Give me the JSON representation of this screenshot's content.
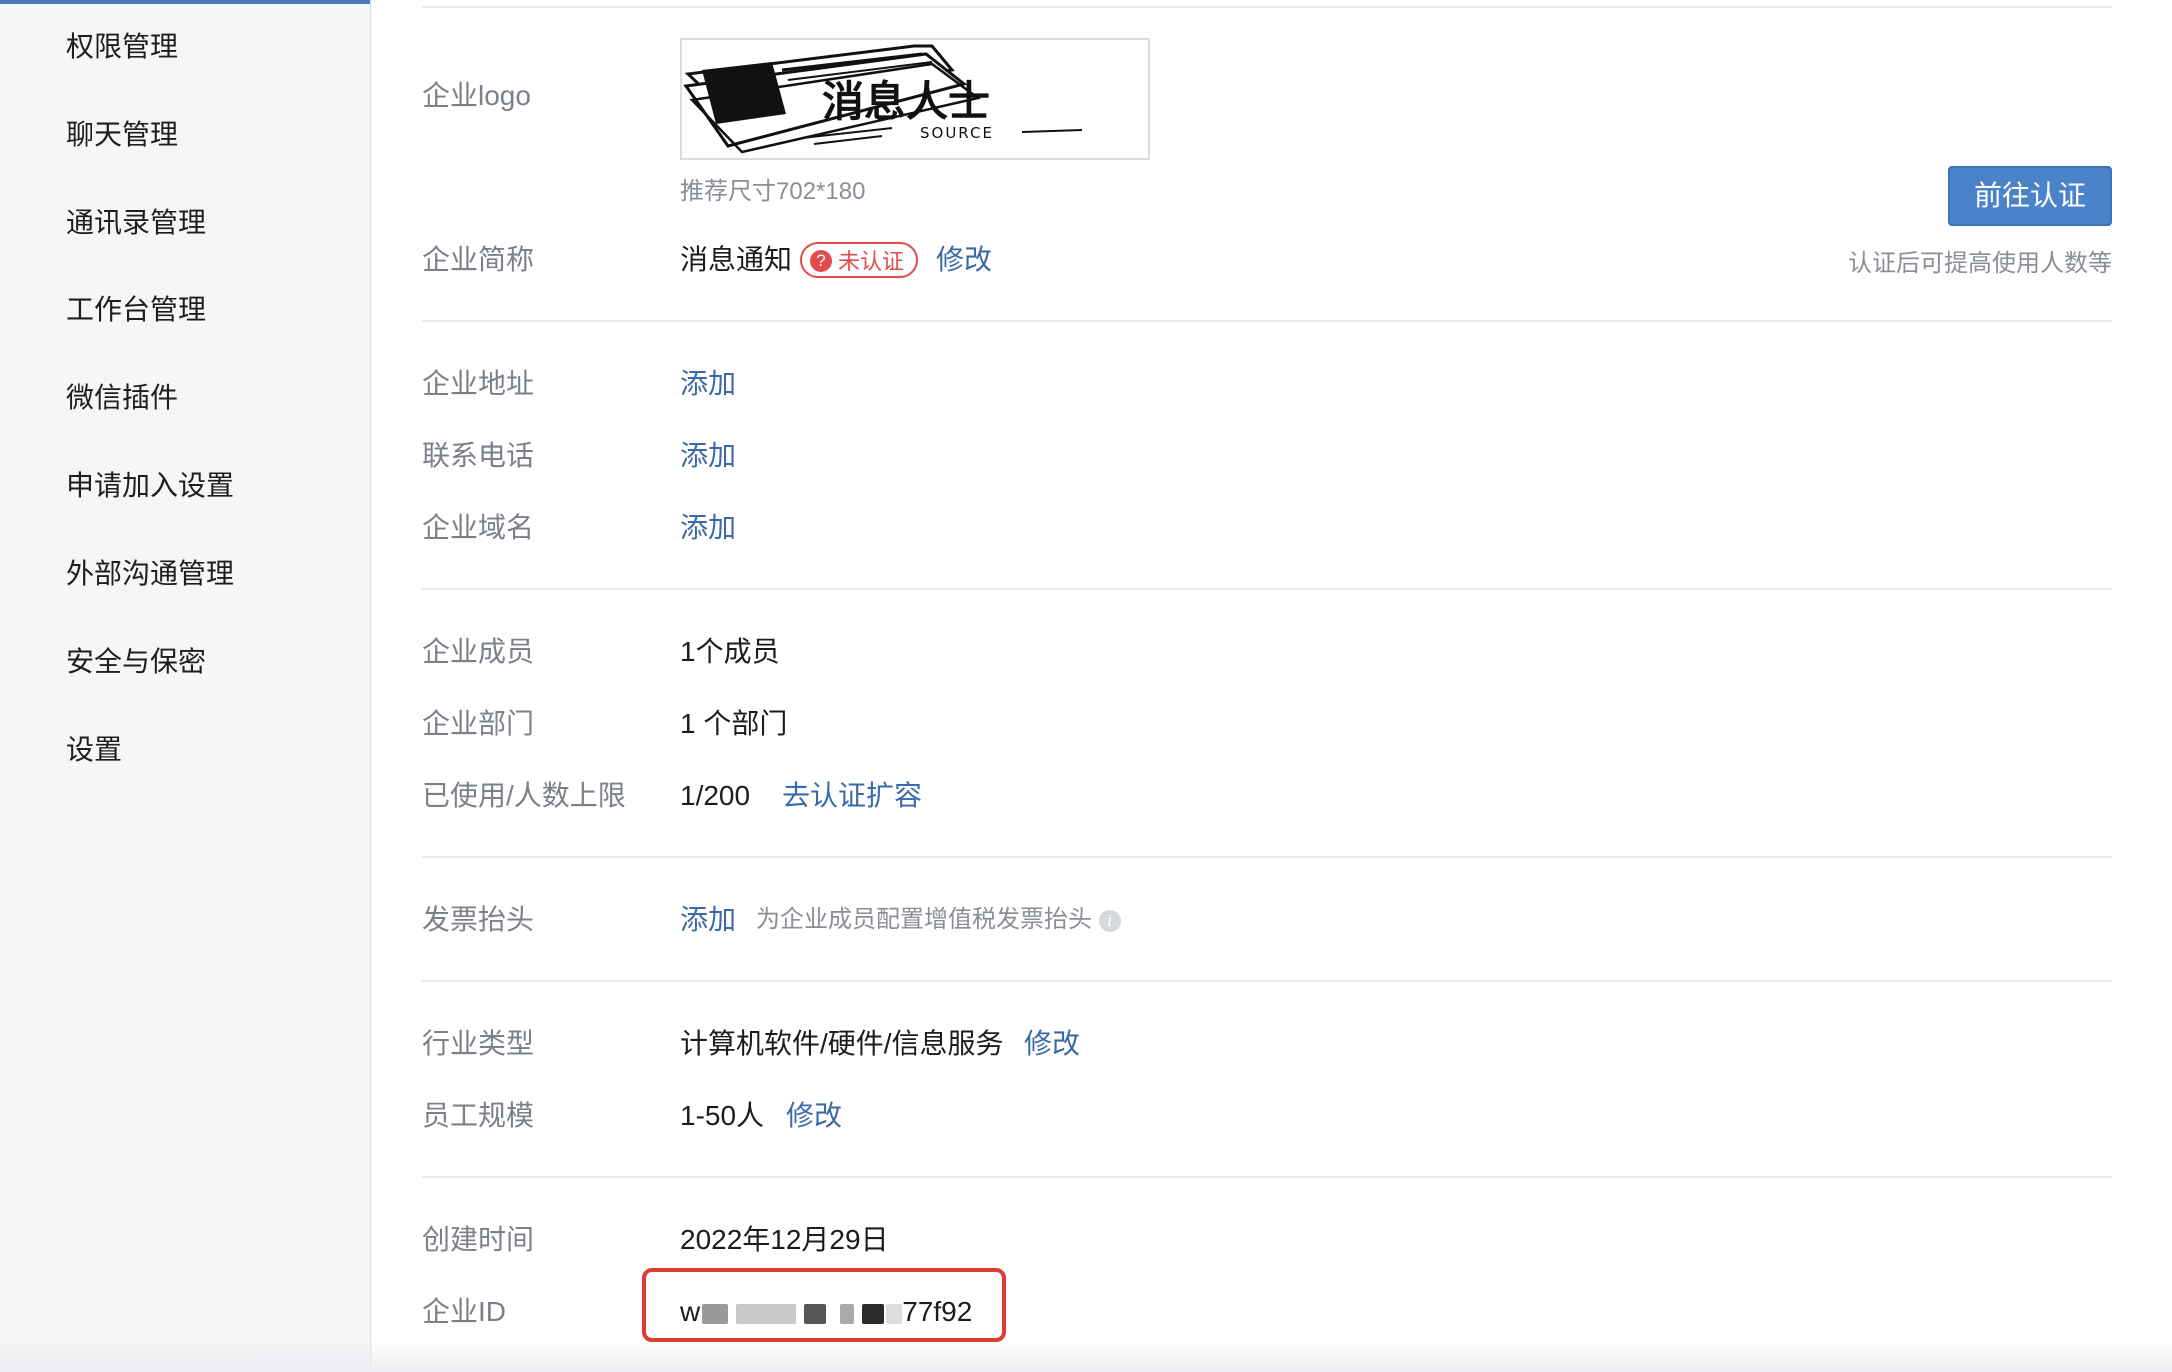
{
  "sidebar": {
    "items": [
      {
        "label": "权限管理"
      },
      {
        "label": "聊天管理"
      },
      {
        "label": "通讯录管理"
      },
      {
        "label": "工作台管理"
      },
      {
        "label": "微信插件"
      },
      {
        "label": "申请加入设置"
      },
      {
        "label": "外部沟通管理"
      },
      {
        "label": "安全与保密"
      },
      {
        "label": "设置"
      }
    ]
  },
  "logo": {
    "label": "企业logo",
    "brand_text": "消息人士",
    "brand_sub": "SOURCE",
    "hint": "推荐尺寸702*180"
  },
  "auth": {
    "button_label": "前往认证",
    "note": "认证后可提高使用人数等"
  },
  "short_name": {
    "label": "企业简称",
    "value": "消息通知",
    "badge": "未认证",
    "badge_icon": "?",
    "edit": "修改"
  },
  "address": {
    "label": "企业地址",
    "action": "添加"
  },
  "phone": {
    "label": "联系电话",
    "action": "添加"
  },
  "domain": {
    "label": "企业域名",
    "action": "添加"
  },
  "members": {
    "label": "企业成员",
    "value": "1个成员"
  },
  "departments": {
    "label": "企业部门",
    "value": "1 个部门"
  },
  "limit": {
    "label": "已使用/人数上限",
    "value": "1/200",
    "action": "去认证扩容"
  },
  "invoice": {
    "label": "发票抬头",
    "action": "添加",
    "hint": "为企业成员配置增值税发票抬头",
    "icon": "i"
  },
  "industry": {
    "label": "行业类型",
    "value": "计算机软件/硬件/信息服务",
    "edit": "修改"
  },
  "scale": {
    "label": "员工规模",
    "value": "1-50人",
    "edit": "修改"
  },
  "created": {
    "label": "创建时间",
    "value": "2022年12月29日"
  },
  "corp_id": {
    "label": "企业ID",
    "value_prefix": "w",
    "value_suffix": "77f92"
  },
  "colors": {
    "link": "#3a6aa8",
    "primary_button": "#4a83c9",
    "unverified_red": "#e54b4b",
    "highlight_red": "#dc3d32"
  }
}
